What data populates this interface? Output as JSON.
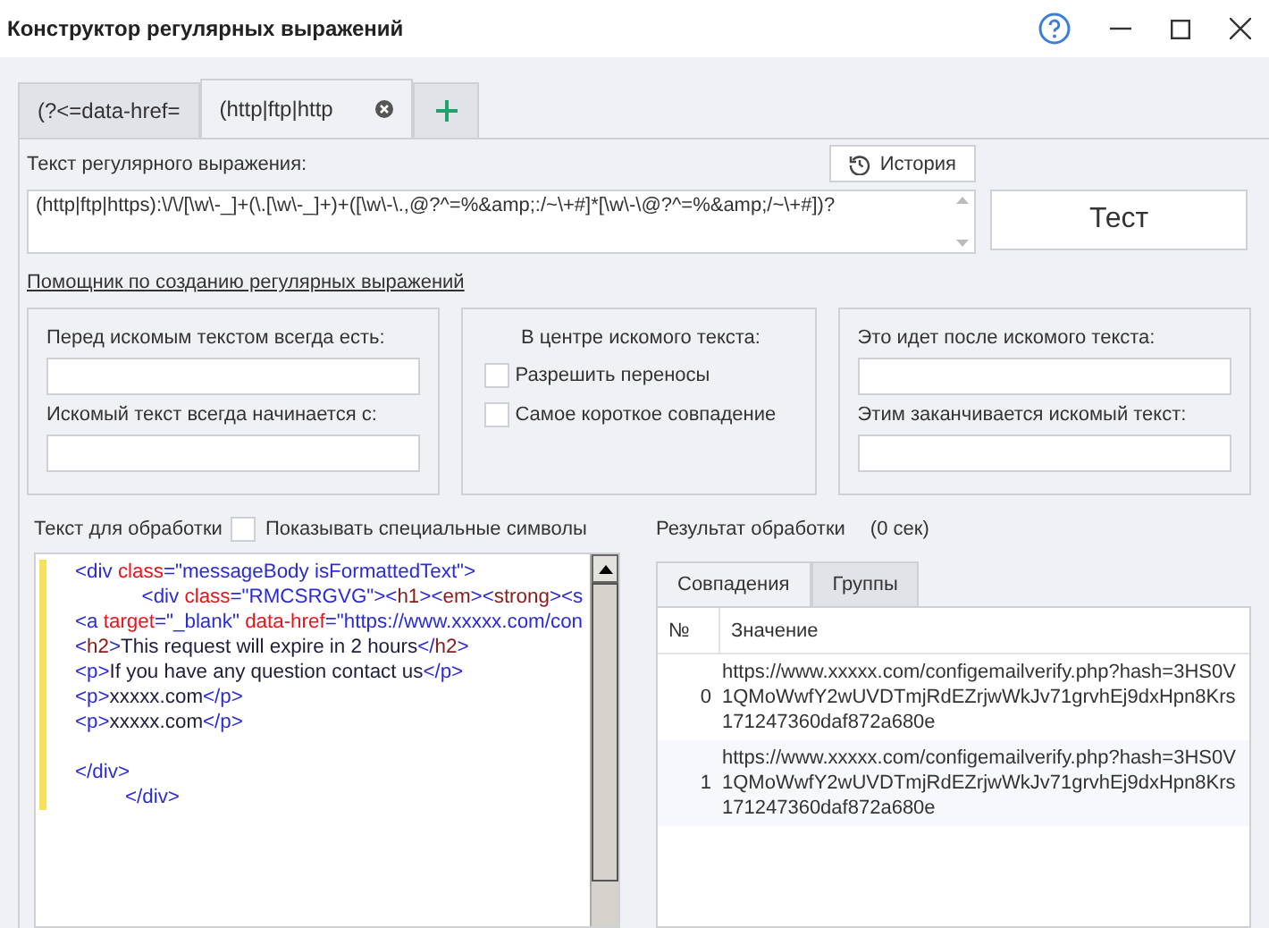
{
  "window": {
    "title": "Конструктор регулярных выражений"
  },
  "tabs": [
    {
      "label": "(?<=data-href=",
      "selected": false,
      "closable": false
    },
    {
      "label": "(http|ftp|http",
      "selected": true,
      "closable": true
    }
  ],
  "regex": {
    "label": "Текст регулярного выражения:",
    "history_button": "История",
    "value": "(http|ftp|https):\\/\\/[\\w\\-_]+(\\.[\\w\\-_]+)+([\\w\\-\\.,@?^=%&amp;:/~\\+#]*[\\w\\-\\@?^=%&amp;/~\\+#])?",
    "test_button": "Тест"
  },
  "helper_link": "Помощник по созданию регулярных выражений",
  "helper": {
    "before": {
      "label": "Перед искомым текстом всегда есть:",
      "starts_label": "Искомый текст всегда начинается с:"
    },
    "center": {
      "label": "В центре искомого текста:",
      "options": [
        {
          "label": "Разрешить переносы",
          "checked": false
        },
        {
          "label": "Самое короткое совпадение",
          "checked": false
        }
      ]
    },
    "after": {
      "label": "Это идет после искомого текста:",
      "ends_label": "Этим заканчивается искомый текст:"
    }
  },
  "input": {
    "label": "Текст для обработки",
    "show_special": {
      "label": "Показывать специальные символы",
      "checked": false
    },
    "lines": [
      [
        {
          "kind": "tag",
          "text": "<div "
        },
        {
          "kind": "attr",
          "text": "class"
        },
        {
          "kind": "tag",
          "text": "="
        },
        {
          "kind": "value",
          "text": "\"messageBody isFormattedText\""
        },
        {
          "kind": "tag",
          "text": ">"
        }
      ],
      [
        {
          "kind": "tag",
          "text": "            <div "
        },
        {
          "kind": "attr",
          "text": "class"
        },
        {
          "kind": "tag",
          "text": "="
        },
        {
          "kind": "value",
          "text": "\"RMCSRGVG\""
        },
        {
          "kind": "tag",
          "text": "><"
        },
        {
          "kind": "name",
          "text": "h1"
        },
        {
          "kind": "tag",
          "text": "><"
        },
        {
          "kind": "name",
          "text": "em"
        },
        {
          "kind": "tag",
          "text": "><"
        },
        {
          "kind": "name",
          "text": "strong"
        },
        {
          "kind": "tag",
          "text": "><s"
        }
      ],
      [
        {
          "kind": "tag",
          "text": "<a "
        },
        {
          "kind": "attr",
          "text": "target"
        },
        {
          "kind": "tag",
          "text": "="
        },
        {
          "kind": "value",
          "text": "\"_blank\" "
        },
        {
          "kind": "attr",
          "text": "data-href"
        },
        {
          "kind": "tag",
          "text": "="
        },
        {
          "kind": "value",
          "text": "\"https://www.xxxxx.com/con"
        }
      ],
      [
        {
          "kind": "tag",
          "text": "<"
        },
        {
          "kind": "name",
          "text": "h2"
        },
        {
          "kind": "tag",
          "text": ">"
        },
        {
          "kind": "text",
          "text": "This request will expire in 2 hours"
        },
        {
          "kind": "tag",
          "text": "</"
        },
        {
          "kind": "name",
          "text": "h2"
        },
        {
          "kind": "tag",
          "text": ">"
        }
      ],
      [
        {
          "kind": "tag",
          "text": "<p>"
        },
        {
          "kind": "text",
          "text": "If you have any question contact us"
        },
        {
          "kind": "tag",
          "text": "</p>"
        }
      ],
      [
        {
          "kind": "tag",
          "text": "<p>"
        },
        {
          "kind": "text",
          "text": "xxxxx.com"
        },
        {
          "kind": "tag",
          "text": "</p>"
        }
      ],
      [
        {
          "kind": "tag",
          "text": "<p>"
        },
        {
          "kind": "text",
          "text": "xxxxx.com"
        },
        {
          "kind": "tag",
          "text": "</p>"
        }
      ],
      {
        "kind": "blank"
      },
      [
        {
          "kind": "tag",
          "text": "</div>"
        }
      ],
      [
        {
          "kind": "tag",
          "text": "         </div>"
        }
      ]
    ]
  },
  "result": {
    "label": "Результат обработки",
    "time": "(0 сек)",
    "tabs": [
      {
        "label": "Совпадения",
        "selected": true
      },
      {
        "label": "Группы",
        "selected": false
      }
    ],
    "columns": [
      "№",
      "Значение"
    ],
    "rows": [
      {
        "index": "0",
        "value": "https://www.xxxxx.com/configemailverify.php?hash=3HS0V1QMoWwfY2wUVDTmjRdEZrjwWkJv71grvhEj9dxHpn8Krs171247360daf872a680e"
      },
      {
        "index": "1",
        "value": "https://www.xxxxx.com/configemailverify.php?hash=3HS0V1QMoWwfY2wUVDTmjRdEZrjwWkJv71grvhEj9dxHpn8Krs171247360daf872a680e"
      }
    ]
  }
}
